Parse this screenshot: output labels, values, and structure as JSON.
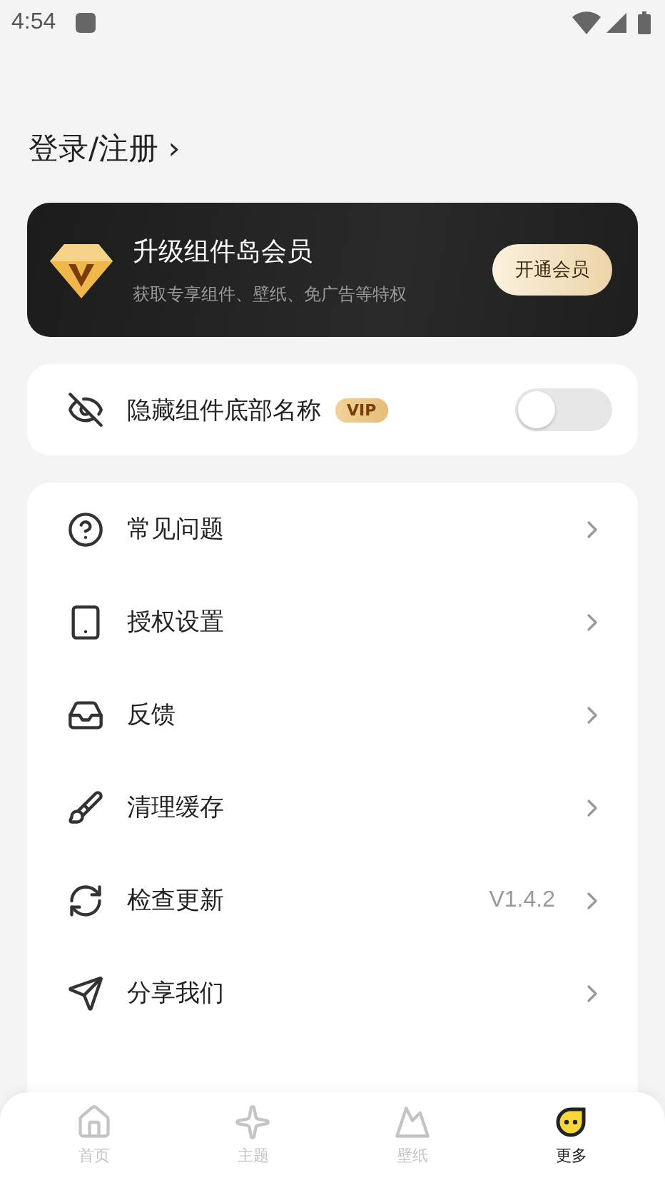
{
  "status_bar": {
    "time": "4:54"
  },
  "login": {
    "label": "登录/注册",
    "chevron": "›"
  },
  "vip_banner": {
    "title": "升级组件岛会员",
    "subtitle": "获取专享组件、壁纸、免广告等特权",
    "button": "开通会员"
  },
  "hide_name_setting": {
    "label": "隐藏组件底部名称",
    "badge": "VIP",
    "on": false
  },
  "menu": [
    {
      "kind": "help",
      "label": "常见问题"
    },
    {
      "kind": "auth",
      "label": "授权设置"
    },
    {
      "kind": "feedback",
      "label": "反馈"
    },
    {
      "kind": "clean",
      "label": "清理缓存"
    },
    {
      "kind": "update",
      "label": "检查更新",
      "value": "V1.4.2"
    },
    {
      "kind": "share",
      "label": "分享我们"
    }
  ],
  "bottom_nav": [
    {
      "kind": "home",
      "label": "首页",
      "selected": false
    },
    {
      "kind": "theme",
      "label": "主题",
      "selected": false
    },
    {
      "kind": "wallpaper",
      "label": "壁纸",
      "selected": false
    },
    {
      "kind": "more",
      "label": "更多",
      "selected": true
    }
  ]
}
